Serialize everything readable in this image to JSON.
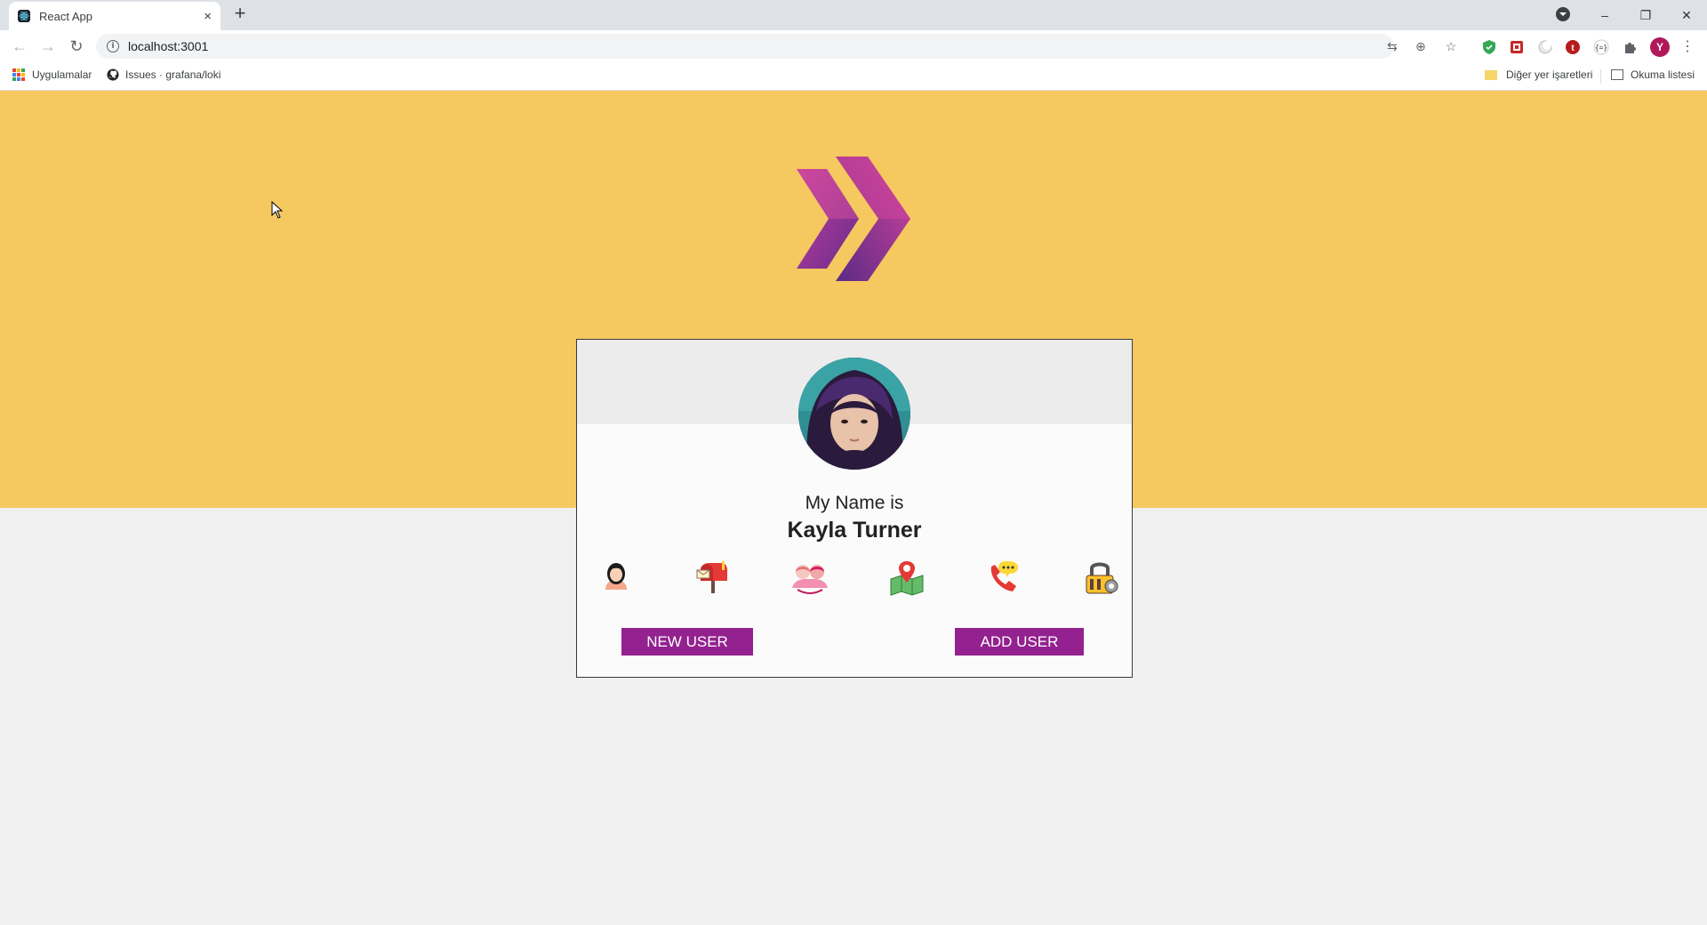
{
  "browser": {
    "tab_title": "React App",
    "tab_close": "×",
    "new_tab": "+",
    "url": "localhost:3001",
    "info_symbol": "i",
    "profile_initial": "Y",
    "nav": {
      "back": "←",
      "forward": "→",
      "reload": "↻"
    },
    "window_controls": {
      "minimize": "–",
      "restore": "❐",
      "close": "✕"
    },
    "omnibox_icons": {
      "translate": "⇆",
      "zoom": "⊕",
      "bookmark": "☆"
    },
    "menu": "⋮"
  },
  "bookmarks": {
    "apps": "Uygulamalar",
    "issues": "Issues · grafana/loki",
    "other": "Diğer yer işaretleri",
    "reading_list": "Okuma listesi"
  },
  "card": {
    "intro": "My Name is",
    "name": "Kayla Turner",
    "info_icons": [
      "person-icon",
      "mailbox-icon",
      "age-icon",
      "map-icon",
      "phone-icon",
      "lock-icon"
    ],
    "new_user_label": "NEW USER",
    "add_user_label": "ADD USER"
  },
  "colors": {
    "hero": "#f6c860",
    "button": "#93218f",
    "page": "#f0f0f0"
  }
}
